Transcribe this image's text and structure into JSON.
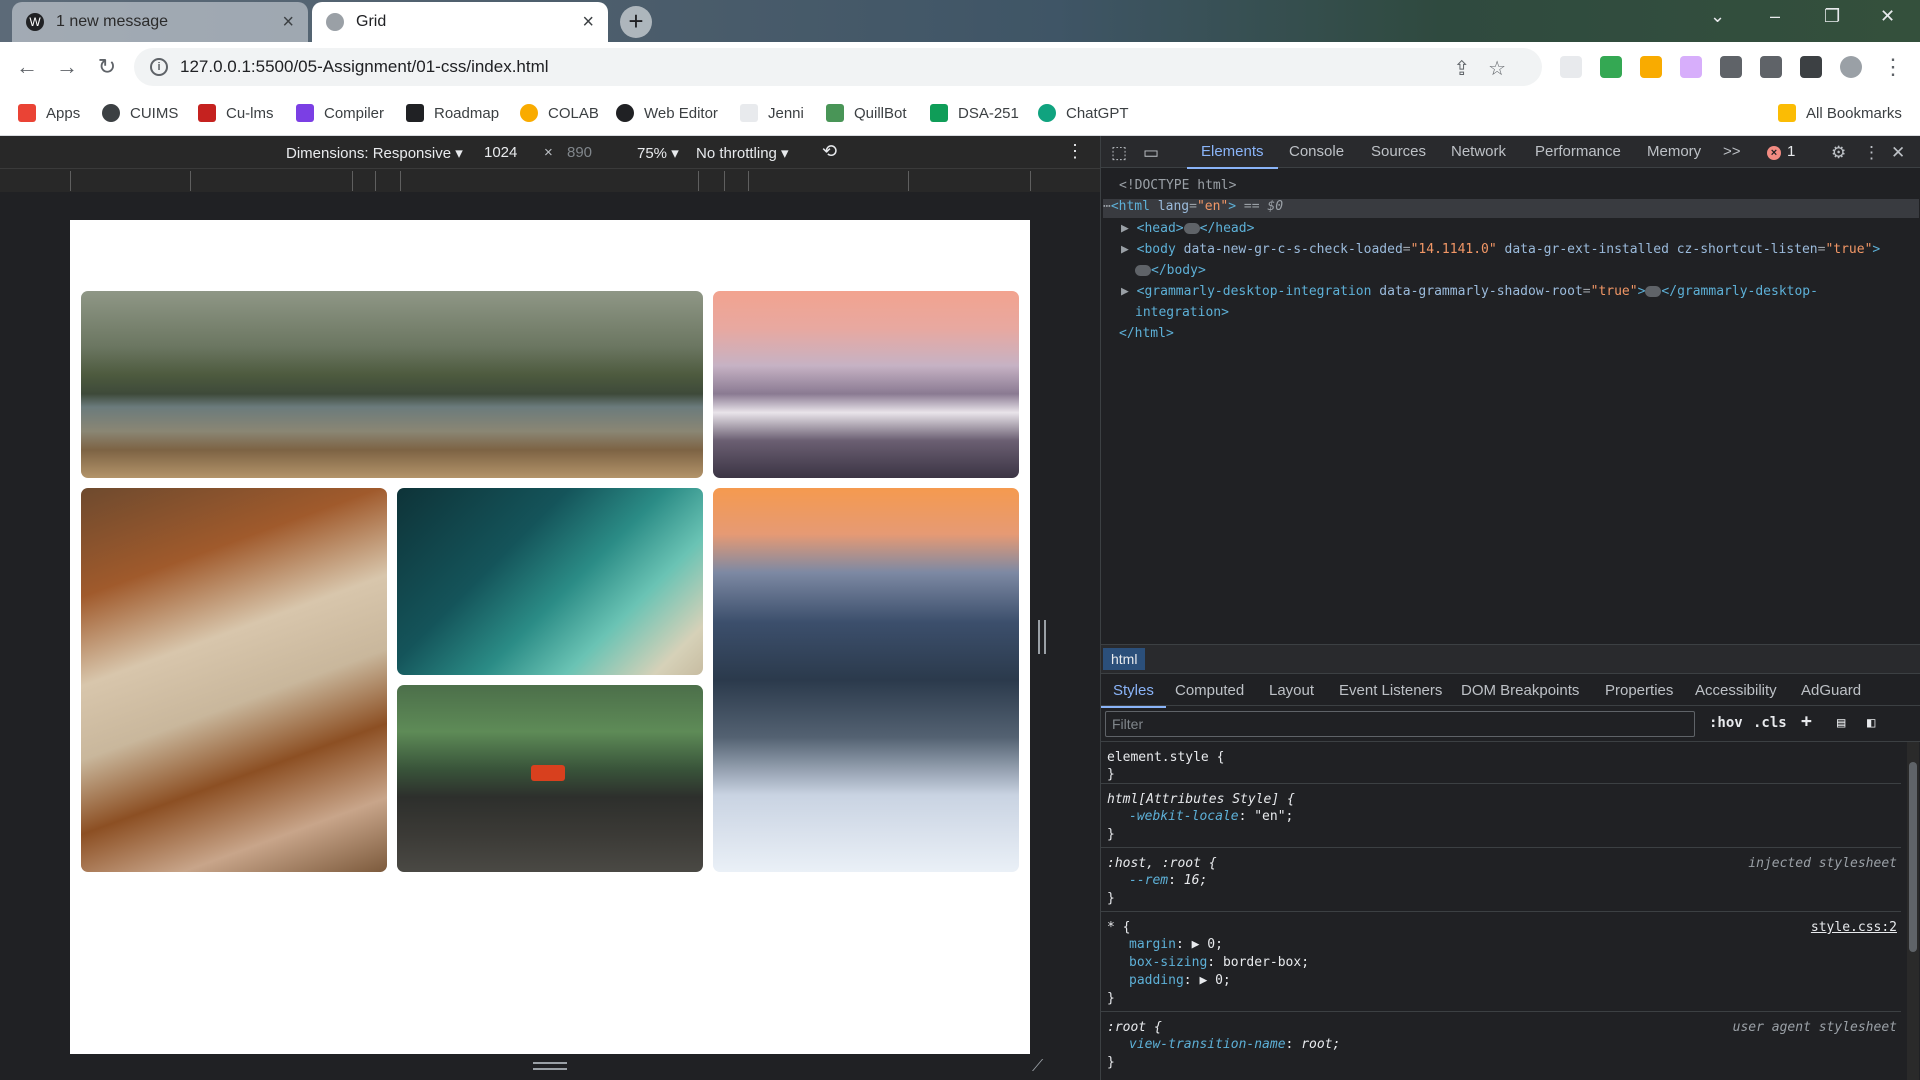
{
  "browser": {
    "tabs": [
      {
        "title": "1 new message",
        "active": false
      },
      {
        "title": "Grid",
        "active": true
      }
    ],
    "url": "127.0.0.1:5500/05-Assignment/01-css/index.html",
    "bookmarks": [
      "Apps",
      "CUIMS",
      "Cu-lms",
      "Compiler",
      "Roadmap",
      "COLAB",
      "Web Editor",
      "Jenni",
      "QuillBot",
      "DSA-251",
      "ChatGPT"
    ],
    "all_bookmarks": "All Bookmarks"
  },
  "device_toolbar": {
    "dimensions": "Dimensions: Responsive ▾",
    "width": "1024",
    "times": "×",
    "height": "890",
    "zoom": "75% ▾",
    "throttling": "No throttling ▾"
  },
  "page": {
    "photos": [
      {
        "name": "beach-photo",
        "alt": "beach"
      },
      {
        "name": "mountain-photo",
        "alt": "mountain"
      },
      {
        "name": "forest-road-photo",
        "alt": "forest road"
      },
      {
        "name": "ocean-photo",
        "alt": "ocean"
      },
      {
        "name": "car-valley-photo",
        "alt": "car valley"
      },
      {
        "name": "snow-tree-photo",
        "alt": "snow tree"
      }
    ]
  },
  "devtools": {
    "tabs": [
      "Elements",
      "Console",
      "Sources",
      "Network",
      "Performance",
      "Memory"
    ],
    "more": ">>",
    "error_count": "1",
    "dom": {
      "doctype": "<!DOCTYPE html>",
      "html_open": "<html",
      "html_lang_attr": "lang",
      "html_lang_val": "\"en\"",
      "html_close_bracket": ">",
      "eq": "== $0",
      "head_open": "<head>",
      "head_close": "</head>",
      "body_open": "<body",
      "body_a1": "data-new-gr-c-s-check-loaded",
      "body_v1": "\"14.1141.0\"",
      "body_a2": "data-gr-ext-installed",
      "body_a3": "cz-shortcut-listen",
      "body_v3": "\"true\"",
      "body_end": ">",
      "body_close": "</body>",
      "gram_open": "<grammarly-desktop-integration",
      "gram_a1": "data-grammarly-shadow-root",
      "gram_v1": "\"true\"",
      "gram_close": "</grammarly-desktop-",
      "gram_close2": "integration>",
      "html_close": "</html>"
    },
    "breadcrumb": "html",
    "sub_tabs": [
      "Styles",
      "Computed",
      "Layout",
      "Event Listeners",
      "DOM Breakpoints",
      "Properties",
      "Accessibility",
      "AdGuard"
    ],
    "filter_placeholder": "Filter",
    "filter_buttons": [
      ":hov",
      ".cls"
    ],
    "styles": {
      "r1_sel": "element.style {",
      "close": "}",
      "r2_sel": "html[Attributes Style] {",
      "r2_prop": "-webkit-locale",
      "r2_val": "\"en\";",
      "r3_sel": ":host, :root {",
      "r3_src": "injected stylesheet",
      "r3_prop": "--rem",
      "r3_val": "16;",
      "r4_sel": "* {",
      "r4_src": "style.css:2",
      "r4_p1": "margin",
      "r4_v1": "▶ 0;",
      "r4_p2": "box-sizing",
      "r4_v2": "border-box;",
      "r4_p3": "padding",
      "r4_v3": "▶ 0;",
      "r5_sel": ":root {",
      "r5_src": "user agent stylesheet",
      "r5_prop": "view-transition-name",
      "r5_val": "root;"
    }
  }
}
